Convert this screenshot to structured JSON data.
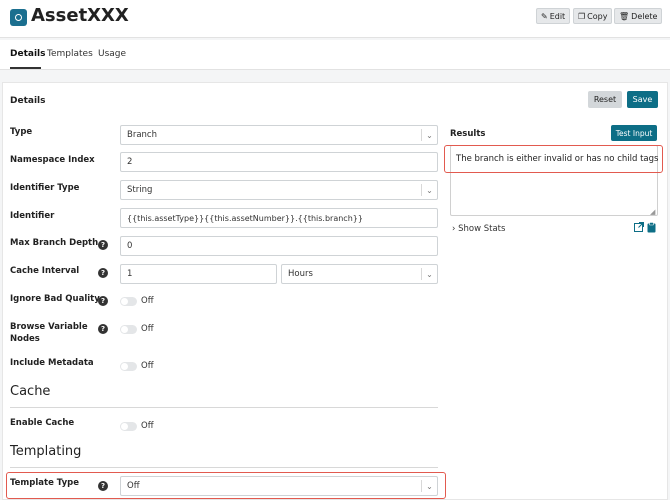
{
  "header": {
    "title": "AssetXXX",
    "edit_label": "Edit",
    "copy_label": "Copy",
    "delete_label": "Delete"
  },
  "tabs": [
    "Details",
    "Templates",
    "Usage"
  ],
  "details": {
    "section_title": "Details",
    "reset_label": "Reset",
    "save_label": "Save",
    "help_glyph": "?",
    "fields": {
      "type": {
        "label": "Type",
        "value": "Branch"
      },
      "namespace_index": {
        "label": "Namespace Index",
        "value": "2"
      },
      "identifier_type": {
        "label": "Identifier Type",
        "value": "String"
      },
      "identifier": {
        "label": "Identifier",
        "value": "{{this.assetType}}{{this.assetNumber}}.{{this.branch}}"
      },
      "max_branch_depth": {
        "label": "Max Branch Depth",
        "value": "0"
      },
      "cache_interval": {
        "label": "Cache Interval",
        "value": "1",
        "unit": "Hours"
      },
      "ignore_bad_quality": {
        "label": "Ignore Bad Quality",
        "value": "Off"
      },
      "browse_variable_nodes": {
        "label": "Browse Variable Nodes",
        "value": "Off"
      },
      "include_metadata": {
        "label": "Include Metadata",
        "value": "Off"
      }
    }
  },
  "cache": {
    "heading": "Cache",
    "enable_cache": {
      "label": "Enable Cache",
      "value": "Off"
    }
  },
  "templating": {
    "heading": "Templating",
    "template_type": {
      "label": "Template Type",
      "value": "Off"
    }
  },
  "results": {
    "label": "Results",
    "test_input_label": "Test Input",
    "message": "The branch is either invalid or has no child tags",
    "show_stats_label": "Show Stats"
  },
  "colors": {
    "accent": "#0d6e86",
    "highlight": "#e25a4f"
  }
}
